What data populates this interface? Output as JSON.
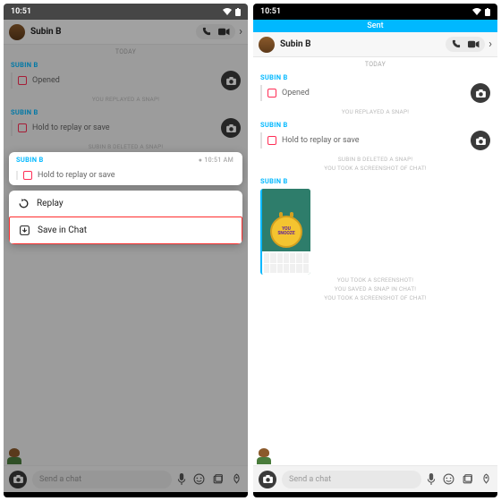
{
  "time": "10:51",
  "contact": "Subin B",
  "day_label": "TODAY",
  "sender_label": "SUBIN B",
  "timestamp": "10:51 AM",
  "opened_label": "Opened",
  "hold_label": "Hold to replay or save",
  "sys_replayed": "YOU REPLAYED A SNAP!",
  "sys_deleted": "SUBIN B DELETED A SNAP!",
  "sys_screenshot_chat": "YOU TOOK A SCREENSHOT OF CHAT!",
  "sys_screenshot": "YOU TOOK A SCREENSHOT!",
  "sys_saved": "YOU SAVED A SNAP IN CHAT!",
  "menu": {
    "replay": "Replay",
    "save": "Save in Chat"
  },
  "input_placeholder": "Send a chat",
  "sent_banner": "Sent",
  "snap_text": {
    "line1": "YOU",
    "line2": "SNOOZE"
  }
}
